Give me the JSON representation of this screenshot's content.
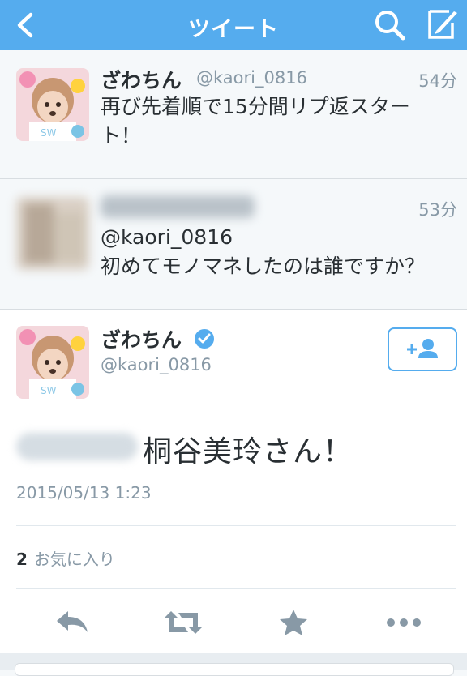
{
  "nav": {
    "title": "ツイート",
    "back_icon": "chevron-left-icon",
    "search_icon": "search-icon",
    "compose_icon": "compose-icon"
  },
  "tweets": [
    {
      "name": "ざわちん",
      "handle": "@kaori_0816",
      "time": "54分",
      "text_line1": "再び先着順で15分間リプ返スター",
      "text_line2": "ト！"
    },
    {
      "name": "",
      "handle": "",
      "time": "53分",
      "text_line1": "@kaori_0816",
      "text_line2": "初めてモノマネしたのは誰ですか？"
    }
  ],
  "detail": {
    "name": "ざわちん",
    "verified_icon": "verified-badge-icon",
    "handle": "@kaori_0816",
    "follow_icon": "follow-user-icon",
    "text": "桐谷美玲さん！",
    "timestamp": "2015/05/13 1:23",
    "favorites_count": "2",
    "favorites_label": "お気に入り",
    "actions": [
      "reply-icon",
      "retweet-icon",
      "favorite-star-icon",
      "more-icon"
    ]
  },
  "colors": {
    "brand": "#55acee",
    "text": "#292f33",
    "muted": "#8899a6"
  }
}
